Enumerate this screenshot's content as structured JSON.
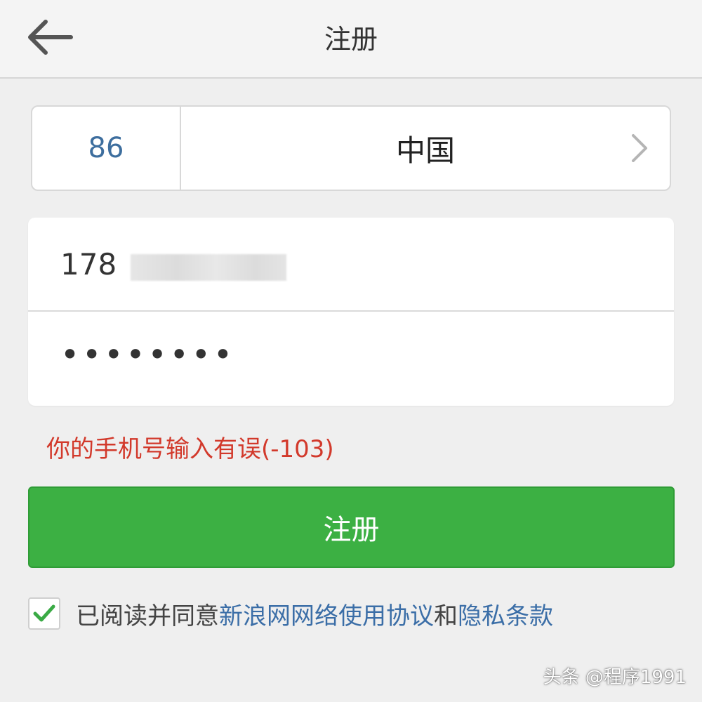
{
  "header": {
    "title": "注册",
    "back_icon": "arrow-left-icon"
  },
  "country": {
    "code": "86",
    "name": "中国",
    "chevron_icon": "chevron-right-icon"
  },
  "form": {
    "phone_value": "178",
    "password_masked": "••••••••"
  },
  "error": {
    "message": "你的手机号输入有误(-103)",
    "color": "#d2392b"
  },
  "register_button": {
    "label": "注册",
    "color": "#3cb043"
  },
  "agreement": {
    "checked": true,
    "prefix": "已阅读并同意",
    "terms_link": "新浪网网络使用协议",
    "conjunction": "和",
    "privacy_link": "隐私条款",
    "link_color": "#3b6ea7"
  },
  "watermark": "头条 @程序1991"
}
